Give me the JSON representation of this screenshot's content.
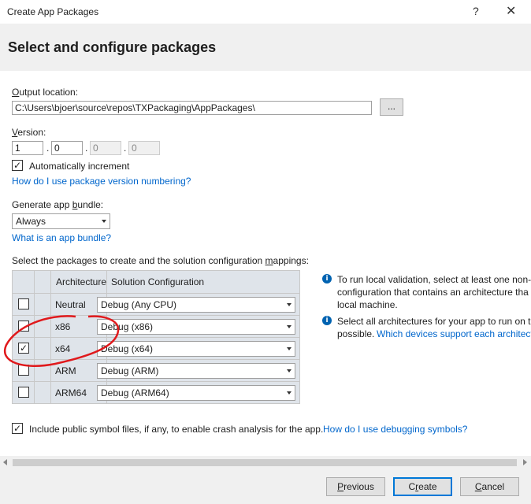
{
  "window": {
    "title": "Create App Packages",
    "help_glyph": "?",
    "close_glyph": "✕"
  },
  "header": {
    "title": "Select and configure packages"
  },
  "output": {
    "label": "Output location:",
    "path": "C:\\Users\\bjoer\\source\\repos\\TXPackaging\\AppPackages\\",
    "browse_label": "..."
  },
  "version": {
    "label": "Version:",
    "parts": [
      "1",
      "0",
      "0",
      "0"
    ],
    "separator": ".",
    "auto_increment_label": "Automatically increment",
    "auto_increment_checked": true,
    "help_link": "How do I use package version numbering?"
  },
  "bundle": {
    "label": "Generate app bundle:",
    "selected": "Always",
    "help_link": "What is an app bundle?"
  },
  "packages": {
    "label": "Select the packages to create and the solution configuration mappings:",
    "columns": [
      "Architecture",
      "Solution Configuration"
    ],
    "rows": [
      {
        "arch": "Neutral",
        "config": "Debug (Any CPU)",
        "checked": false
      },
      {
        "arch": "x86",
        "config": "Debug (x86)",
        "checked": false
      },
      {
        "arch": "x64",
        "config": "Debug (x64)",
        "checked": true
      },
      {
        "arch": "ARM",
        "config": "Debug (ARM)",
        "checked": false
      },
      {
        "arch": "ARM64",
        "config": "Debug (ARM64)",
        "checked": false
      }
    ]
  },
  "info": {
    "line1a": "To run local validation, select at least one non-",
    "line1b": "configuration that contains an architecture tha",
    "line1c": "local machine.",
    "line2a": "Select all architectures for your app to run on t",
    "line2b": "possible.",
    "line2_link": "Which devices support each architect"
  },
  "symbols": {
    "label": "Include public symbol files, if any, to enable crash analysis for the app.",
    "checked": true,
    "help_link": "How do I use debugging symbols?"
  },
  "footer": {
    "previous": "Previous",
    "create": "Create",
    "cancel": "Cancel"
  },
  "colors": {
    "link": "#0066cc",
    "header_bg": "#f0f0f0",
    "grid_bg": "#dfe4ea",
    "annotation": "#e0191c",
    "primary_border": "#0078d7"
  }
}
